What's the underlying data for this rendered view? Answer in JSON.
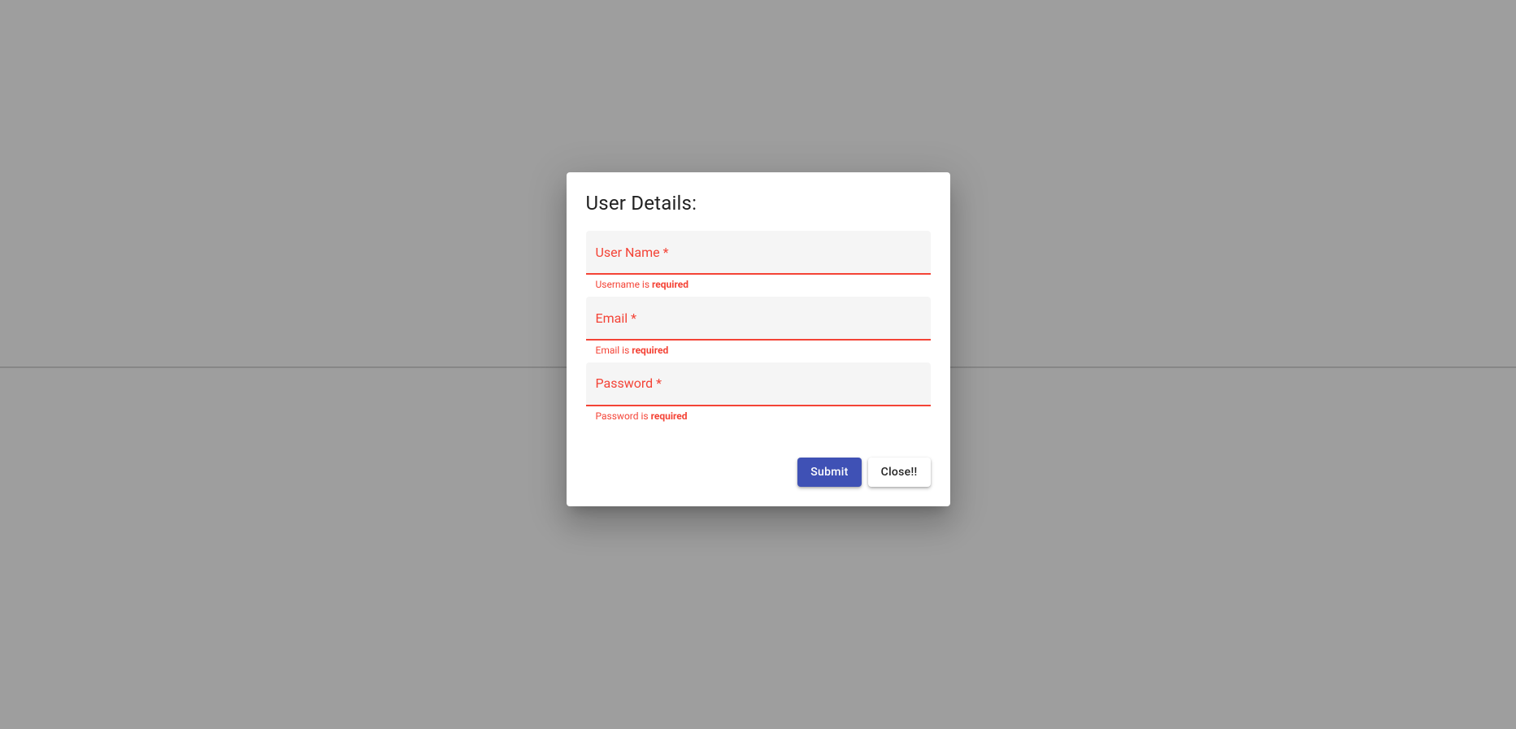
{
  "dialog": {
    "title": "User Details:",
    "fields": {
      "username": {
        "label": "User Name *",
        "error_prefix": "Username is ",
        "error_strong": "required"
      },
      "email": {
        "label": "Email *",
        "error_prefix": "Email is ",
        "error_strong": "required"
      },
      "password": {
        "label": "Password *",
        "error_prefix": "Password is ",
        "error_strong": "required"
      }
    },
    "actions": {
      "submit": "Submit",
      "close": "Close!!"
    }
  },
  "colors": {
    "error": "#f44336",
    "primary": "#3f51b5",
    "backdrop": "#9e9e9e"
  }
}
